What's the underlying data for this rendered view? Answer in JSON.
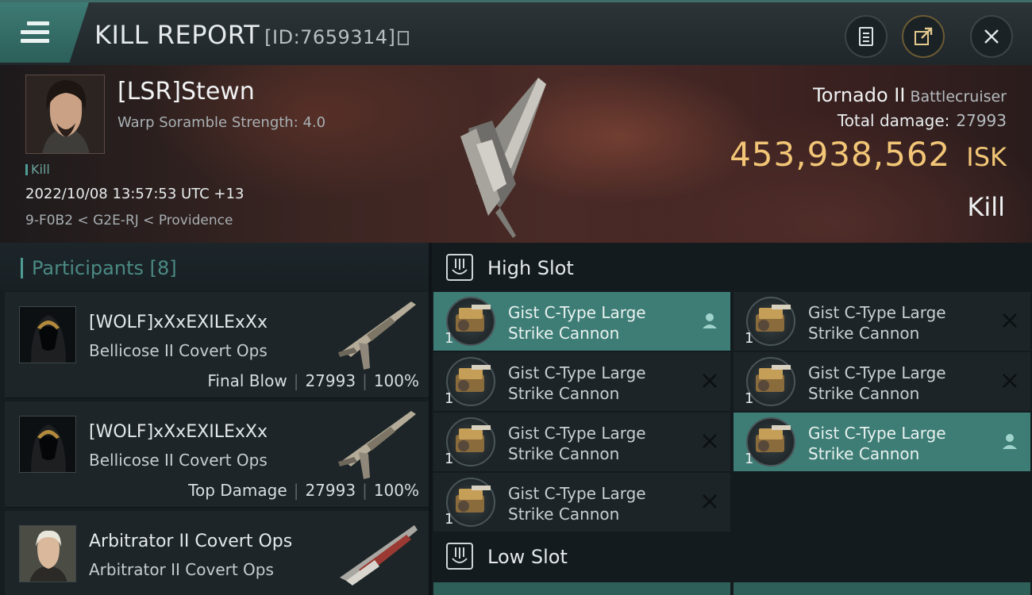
{
  "header": {
    "title": "KILL REPORT",
    "report_id": "[ID:7659314]"
  },
  "victim": {
    "pilot_name": "[LSR]Stewn",
    "scramble": "Warp Soramble Strength: 4.0",
    "tag": "Kill",
    "datetime": "2022/10/08 13:57:53 UTC +13",
    "location": "9-F0B2 < G2E-RJ < Providence",
    "ship_name": "Tornado II",
    "ship_class": "Battlecruiser",
    "total_damage_label": "Total damage:",
    "total_damage": "27993",
    "isk_value": "453,938,562",
    "isk_unit": "ISK",
    "result": "Kill"
  },
  "participants": {
    "label": "Participants",
    "count": "[8]",
    "items": [
      {
        "name": "[WOLF]xXxEXILExXx",
        "ship": "Bellicose II Covert Ops",
        "role": "Final Blow",
        "damage": "27993",
        "percent": "100%"
      },
      {
        "name": "[WOLF]xXxEXILExXx",
        "ship": "Bellicose II Covert Ops",
        "role": "Top Damage",
        "damage": "27993",
        "percent": "100%"
      },
      {
        "name": "Arbitrator II Covert Ops",
        "ship": "Arbitrator II Covert Ops"
      }
    ]
  },
  "slots": {
    "high_label": "High Slot",
    "low_label": "Low Slot",
    "high": [
      {
        "line1": "Gist C-Type Large",
        "line2": "Strike Cannon",
        "qty": "1",
        "state": "pilot",
        "active": true
      },
      {
        "line1": "Gist C-Type Large",
        "line2": "Strike Cannon",
        "qty": "1",
        "state": "destroyed",
        "active": false
      },
      {
        "line1": "Gist C-Type Large",
        "line2": "Strike Cannon",
        "qty": "1",
        "state": "destroyed",
        "active": false
      },
      {
        "line1": "Gist C-Type Large",
        "line2": "Strike Cannon",
        "qty": "1",
        "state": "destroyed",
        "active": false
      },
      {
        "line1": "Gist C-Type Large",
        "line2": "Strike Cannon",
        "qty": "1",
        "state": "destroyed",
        "active": false
      },
      {
        "line1": "Gist C-Type Large",
        "line2": "Strike Cannon",
        "qty": "1",
        "state": "pilot",
        "active": true
      },
      {
        "line1": "Gist C-Type Large",
        "line2": "Strike Cannon",
        "qty": "1",
        "state": "destroyed",
        "active": false
      }
    ]
  },
  "colors": {
    "accent": "#3d7d75",
    "isk": "#f2c676",
    "participants_label": "#4b8a84"
  },
  "icons": {
    "menu": "hamburger-icon",
    "clipboard": "clipboard-icon",
    "share": "share-icon",
    "close": "close-icon",
    "slot": "slot-icon",
    "pilot": "pilot-icon",
    "destroyed": "x-icon"
  }
}
